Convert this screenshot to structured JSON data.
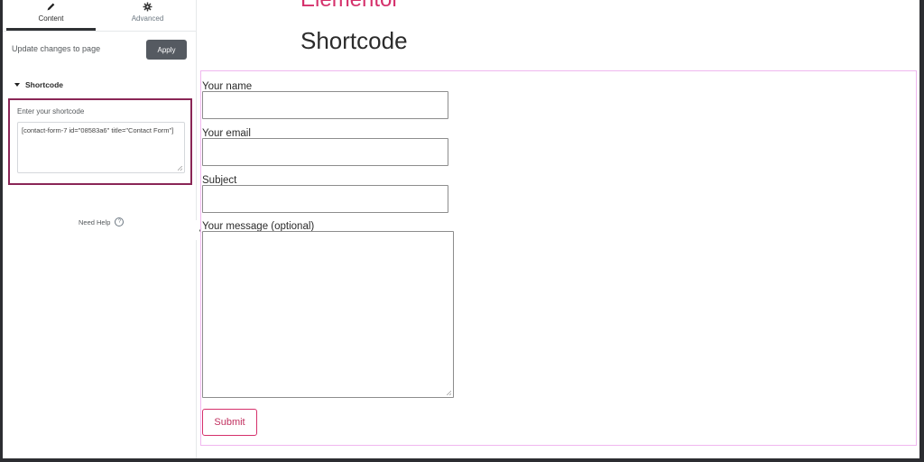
{
  "sidebar": {
    "tabs": [
      {
        "label": "Content",
        "icon": "pencil-icon"
      },
      {
        "label": "Advanced",
        "icon": "gear-icon"
      }
    ],
    "update_text": "Update changes to page",
    "apply_label": "Apply",
    "section_title": "Shortcode",
    "shortcode_label": "Enter your shortcode",
    "shortcode_value": "[contact-form-7 id=\"08583a6\" title=\"Contact Form\"]",
    "need_help": "Need Help",
    "collapse_glyph": "‹"
  },
  "canvas": {
    "brand_partial": "Elementor",
    "page_title": "Shortcode",
    "form": {
      "fields": [
        {
          "label": "Your name"
        },
        {
          "label": "Your email"
        },
        {
          "label": "Subject"
        },
        {
          "label": "Your message (optional)"
        }
      ],
      "submit_label": "Submit"
    }
  },
  "colors": {
    "accent": "#d5306b",
    "highlight_border": "#8a2656",
    "form_border": "#f0b7ef",
    "apply_button": "#555a61"
  }
}
